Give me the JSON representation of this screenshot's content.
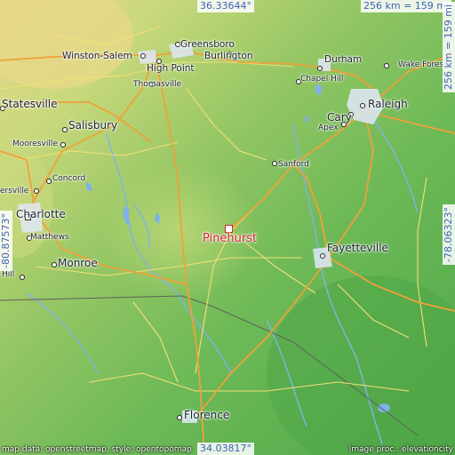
{
  "coordinates": {
    "north": "36.33644°",
    "south": "34.03817°",
    "west": "-80.87573°",
    "east": "-78.06323°",
    "scale": "256 km = 159 mi"
  },
  "highlight": {
    "name": "Pinehurst"
  },
  "places": [
    {
      "id": "greensboro",
      "name": "Greensboro"
    },
    {
      "id": "winston-salem",
      "name": "Winston-Salem"
    },
    {
      "id": "high-point",
      "name": "High Point"
    },
    {
      "id": "burlington",
      "name": "Burlington"
    },
    {
      "id": "durham",
      "name": "Durham"
    },
    {
      "id": "wake-forest",
      "name": "Wake Forest"
    },
    {
      "id": "thomasville",
      "name": "Thomasville"
    },
    {
      "id": "chapel-hill",
      "name": "Chapel Hill"
    },
    {
      "id": "statesville",
      "name": "Statesville"
    },
    {
      "id": "cary",
      "name": "Cary"
    },
    {
      "id": "raleigh",
      "name": "Raleigh"
    },
    {
      "id": "salisbury",
      "name": "Salisbury"
    },
    {
      "id": "apex",
      "name": "Apex"
    },
    {
      "id": "mooresville",
      "name": "Mooresville"
    },
    {
      "id": "sanford",
      "name": "Sanford"
    },
    {
      "id": "concord",
      "name": "Concord"
    },
    {
      "id": "huntersville",
      "name": "ersville"
    },
    {
      "id": "charlotte",
      "name": "Charlotte"
    },
    {
      "id": "fayetteville",
      "name": "Fayetteville"
    },
    {
      "id": "matthews",
      "name": "Matthews"
    },
    {
      "id": "monroe",
      "name": "Monroe"
    },
    {
      "id": "hill",
      "name": "Hill"
    },
    {
      "id": "florence",
      "name": "Florence"
    }
  ],
  "credits": {
    "left": "map data: openstreetmap, style: opentopomap",
    "right": "image proc.: elevationcity"
  },
  "colors": {
    "lowland": "#5fae4c",
    "upland": "#a7cd6a",
    "highland": "#e9d98c",
    "water": "#7fb3e6",
    "major_road": "#f2a33a",
    "minor_road": "#f7e07a",
    "border": "#6b6b6b"
  }
}
